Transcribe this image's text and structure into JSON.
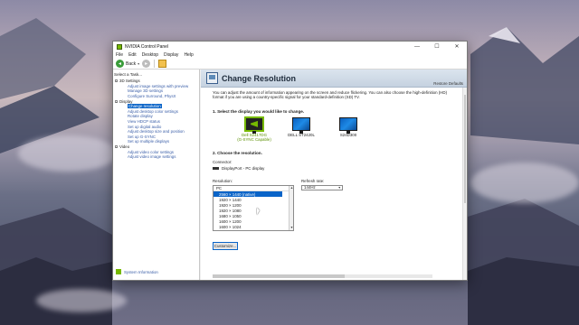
{
  "window": {
    "title": "NVIDIA Control Panel",
    "controls": {
      "minimize": "—",
      "maximize": "☐",
      "close": "✕"
    }
  },
  "menu": [
    "File",
    "Edit",
    "Desktop",
    "Display",
    "Help"
  ],
  "toolbar": {
    "back_label": "Back"
  },
  "sidebar": {
    "task_label": "Select a Task...",
    "categories": [
      {
        "label": "3D Settings",
        "items": [
          "Adjust image settings with preview",
          "Manage 3D settings",
          "Configure Surround, PhysX"
        ]
      },
      {
        "label": "Display",
        "items": [
          "Change resolution",
          "Adjust desktop color settings",
          "Rotate display",
          "View HDCP status",
          "Set up digital audio",
          "Adjust desktop size and position",
          "Set up G-SYNC",
          "Set up multiple displays"
        ]
      },
      {
        "label": "Video",
        "items": [
          "Adjust video color settings",
          "Adjust video image settings"
        ]
      }
    ],
    "selected_item": "Change resolution",
    "system_info": "System Information"
  },
  "page": {
    "title": "Change Resolution",
    "restore": "Restore Defaults",
    "description": "You can adjust the amount of information appearing on the screen and reduce flickering. You can also choose the high-definition (HD) format if you are using a country-specific signal for your standard-definition (SD) TV.",
    "step1": "1. Select the display you would like to change.",
    "displays": [
      {
        "name": "Dell S2417DG",
        "sub": "(G-SYNC Capable)",
        "selected": true
      },
      {
        "name": "DELL ST2420L",
        "sub": "",
        "selected": false
      },
      {
        "name": "S24D300",
        "sub": "",
        "selected": false
      }
    ],
    "step2": "2. Choose the resolution.",
    "connector_label": "Connector:",
    "connector_value": "DisplayPort - PC display",
    "resolution_label": "Resolution:",
    "resolution_group": "PC",
    "resolutions": [
      "2560 × 1440 (native)",
      "1920 × 1440",
      "1920 × 1200",
      "1920 × 1080",
      "1680 × 1050",
      "1600 × 1200",
      "1600 × 1024"
    ],
    "selected_resolution": "2560 × 1440 (native)",
    "refresh_label": "Refresh rate:",
    "refresh_value": "144Hz",
    "customize": "Customize..."
  }
}
